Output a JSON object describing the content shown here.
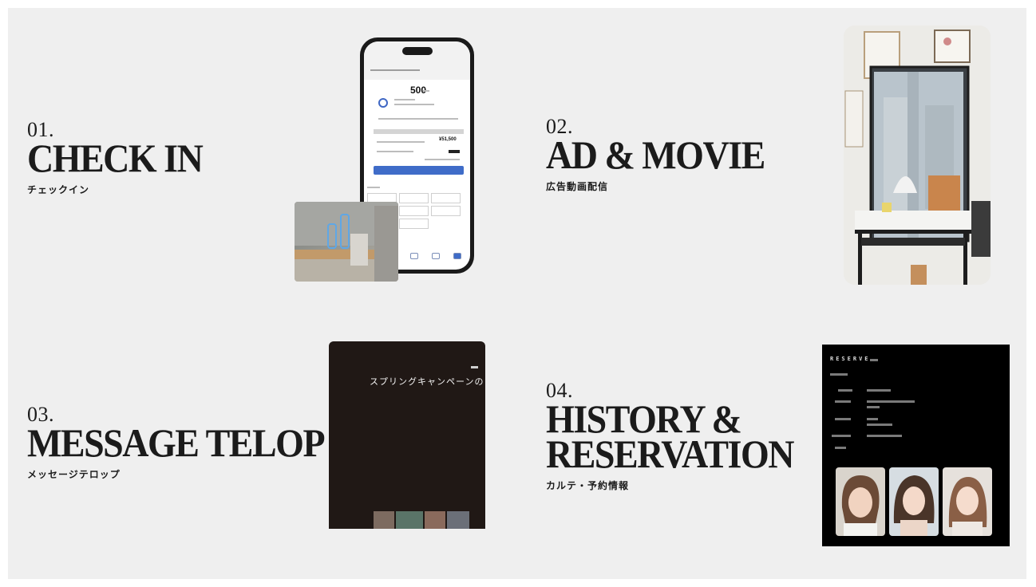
{
  "features": [
    {
      "number": "01.",
      "title": "CHECK IN",
      "subtitle": "チェックイン"
    },
    {
      "number": "02.",
      "title": "AD & MOVIE",
      "subtitle": "広告動画配信"
    },
    {
      "number": "03.",
      "title": "MESSAGE TELOP",
      "subtitle": "メッセージテロップ"
    },
    {
      "number": "04.",
      "title_line1": "HISTORY &",
      "title_line2": "RESERVATION",
      "subtitle": "カルテ・予約情報"
    }
  ],
  "phone": {
    "points": "500",
    "price": "¥51,500"
  },
  "telop": {
    "message": "スプリングキャンペーンの"
  },
  "reserve": {
    "title": "RESERVE"
  },
  "colors": {
    "background": "#efefef",
    "text": "#1b1b1b",
    "accent": "#3f6cc8",
    "telop_bg": "#201815",
    "reserve_bg": "#000000"
  }
}
